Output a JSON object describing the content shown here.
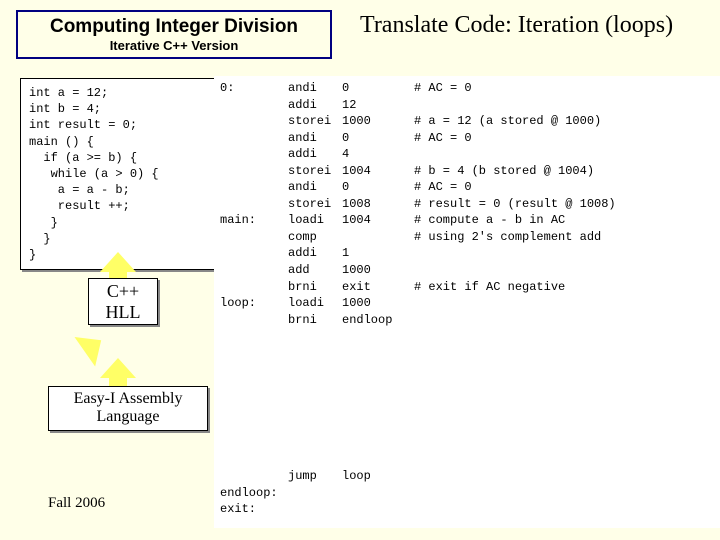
{
  "titleBox": {
    "main": "Computing Integer Division",
    "sub": "Iterative C++ Version"
  },
  "slideTitle": "Translate Code: Iteration (loops)",
  "cppCode": "int a = 12;\nint b = 4;\nint result = 0;\nmain () {\n  if (a >= b) {\n   while (a > 0) {\n    a = a - b;\n    result ++;\n   }\n  }\n}",
  "hllLabel": "C++\nHLL",
  "asmLabel": "Easy-I\nAssembly Language",
  "asm": [
    {
      "label": "0:",
      "op": "andi",
      "arg": "0",
      "comment": "# AC = 0"
    },
    {
      "label": "",
      "op": "addi",
      "arg": "12",
      "comment": ""
    },
    {
      "label": "",
      "op": "storei",
      "arg": "1000",
      "comment": "# a = 12 (a stored @ 1000)"
    },
    {
      "label": "",
      "op": "andi",
      "arg": "0",
      "comment": "# AC = 0"
    },
    {
      "label": "",
      "op": "addi",
      "arg": "4",
      "comment": ""
    },
    {
      "label": "",
      "op": "storei",
      "arg": "1004",
      "comment": "# b = 4 (b stored @ 1004)"
    },
    {
      "label": "",
      "op": "andi",
      "arg": "0",
      "comment": "# AC = 0"
    },
    {
      "label": "",
      "op": "storei",
      "arg": "1008",
      "comment": "# result = 0 (result @ 1008)"
    },
    {
      "label": "main:",
      "op": "loadi",
      "arg": "1004",
      "comment": "# compute a - b in AC"
    },
    {
      "label": "",
      "op": "comp",
      "arg": "",
      "comment": "# using 2's complement add"
    },
    {
      "label": "",
      "op": "addi",
      "arg": "1",
      "comment": ""
    },
    {
      "label": "",
      "op": "add",
      "arg": "1000",
      "comment": ""
    },
    {
      "label": "",
      "op": "brni",
      "arg": "exit",
      "comment": "# exit if AC negative"
    },
    {
      "label": "loop:",
      "op": "loadi",
      "arg": "1000",
      "comment": ""
    },
    {
      "label": "",
      "op": "brni",
      "arg": "endloop",
      "comment": ""
    }
  ],
  "asmTail": [
    {
      "label": "",
      "op": "jump",
      "arg": "loop",
      "comment": ""
    },
    {
      "label": "endloop:",
      "op": "",
      "arg": "",
      "comment": ""
    },
    {
      "label": "exit:",
      "op": "",
      "arg": "",
      "comment": ""
    }
  ],
  "footer": "Fall 2006"
}
